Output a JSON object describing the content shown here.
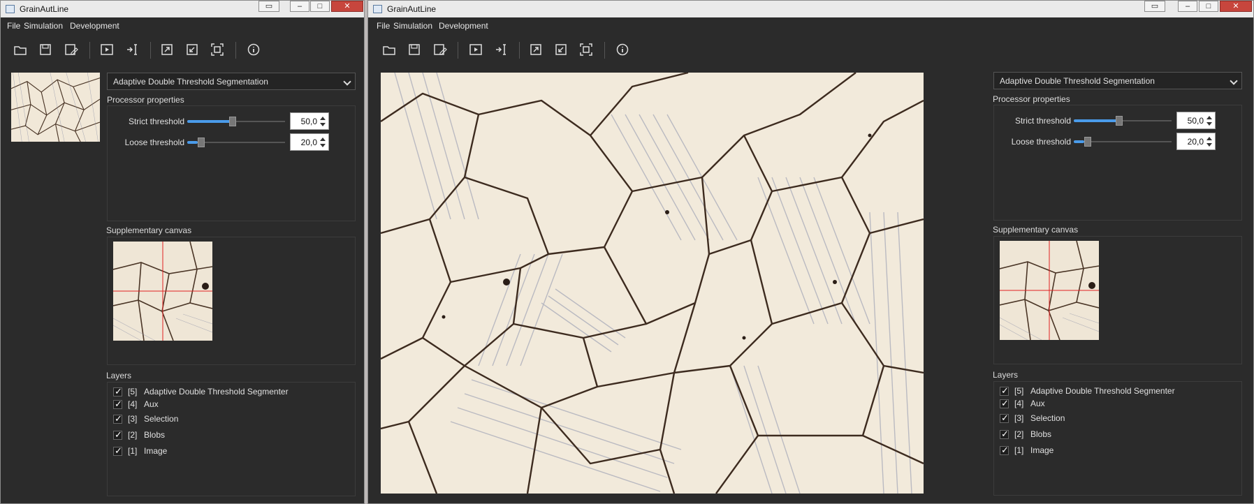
{
  "app": {
    "title": "GrainAutLine"
  },
  "window_controls": {
    "restore_icon": "restore-icon",
    "minimize": "–",
    "maximize": "□",
    "close": "✕"
  },
  "menu": [
    "File",
    "Simulation",
    "Development"
  ],
  "toolbar": {
    "buttons": [
      "open-icon",
      "save-icon",
      "save-as-icon",
      "run-icon",
      "step-icon",
      "expand-icon",
      "collapse-icon",
      "fit-icon",
      "info-icon"
    ]
  },
  "processor": {
    "selected": "Adaptive Double Threshold Segmentation"
  },
  "properties": {
    "title": "Processor properties",
    "strict": {
      "label": "Strict threshold",
      "value": "50,0",
      "fraction": 0.5
    },
    "loose": {
      "label": "Loose threshold",
      "value": "20,0",
      "fraction": 0.12
    }
  },
  "supplementary": {
    "title": "Supplementary canvas"
  },
  "layers": {
    "title": "Layers",
    "items": [
      {
        "index": "[5]",
        "label": "Adaptive Double Threshold Segmenter",
        "checked": true
      },
      {
        "index": "[4]",
        "label": "Aux",
        "checked": true
      },
      {
        "index": "[3]",
        "label": "Selection",
        "checked": true
      },
      {
        "index": "[2]",
        "label": "Blobs",
        "checked": true
      },
      {
        "index": "[1]",
        "label": "Image",
        "checked": true
      }
    ]
  },
  "colors": {
    "accent": "#4a9bea",
    "background": "#2b2b2b",
    "crosshair": "#e02020",
    "grain_line": "#3a2a20"
  }
}
